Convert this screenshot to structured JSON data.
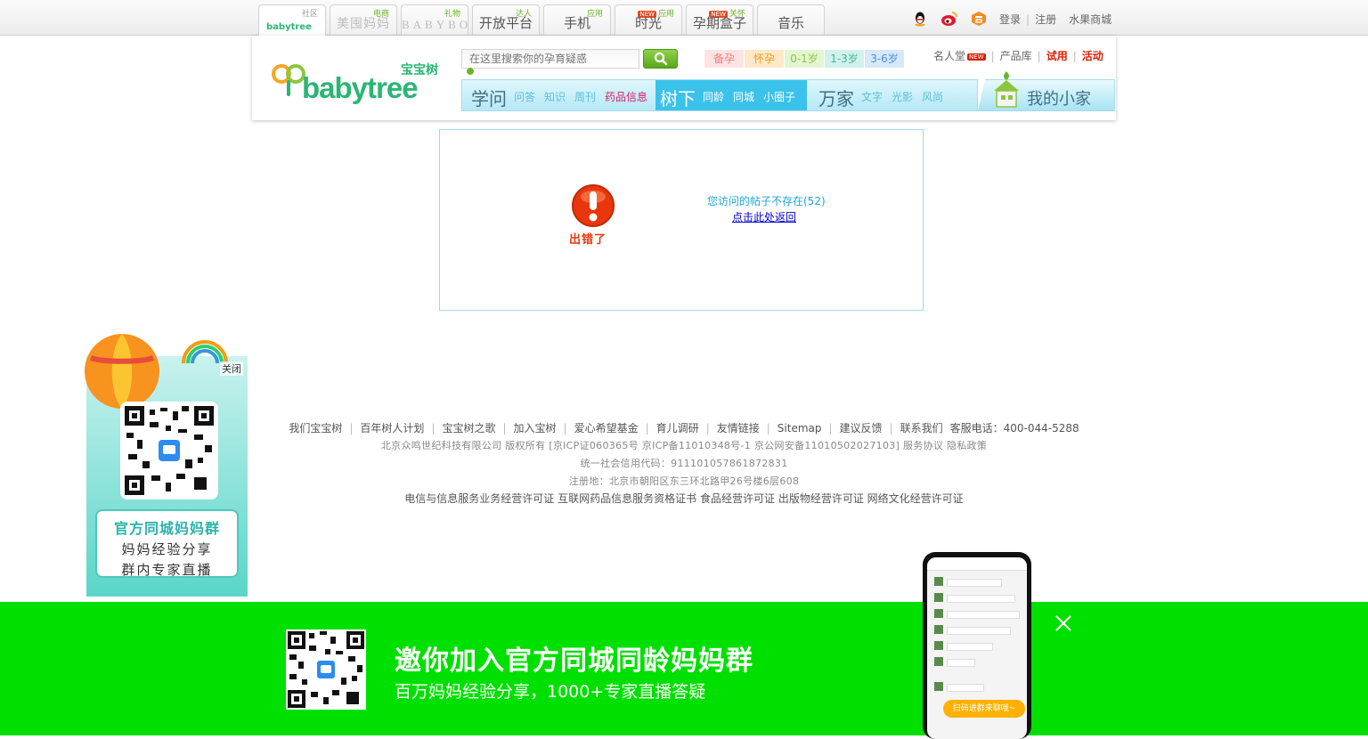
{
  "topbar": {
    "tabs": [
      {
        "tag": "社区",
        "name": "babytree"
      },
      {
        "tag": "电商",
        "name": "美囤妈妈"
      },
      {
        "tag": "礼物",
        "name": "BABYBOX"
      },
      {
        "tag": "达人",
        "name": "开放平台"
      },
      {
        "tag": "应用",
        "name": "手机"
      },
      {
        "tag_new": "NEW",
        "tag": "应用",
        "name": "时光"
      },
      {
        "tag_new": "NEW",
        "tag": "关怀",
        "name": "孕期盒子"
      },
      {
        "tag": "",
        "name": "音乐"
      }
    ],
    "social_icons": [
      "qq-icon",
      "weibo-icon",
      "douban-icon"
    ],
    "links": {
      "login": "登录",
      "register": "注册",
      "mall": "水果商城"
    }
  },
  "header": {
    "brand_cn": "宝宝树",
    "brand_en": "babytree",
    "search_placeholder": "在这里搜索你的孕育疑惑",
    "stages": [
      {
        "label": "备孕",
        "color": "#f08080",
        "bg": "#fde3e3"
      },
      {
        "label": "怀孕",
        "color": "#f39c12",
        "bg": "#fde9c9"
      },
      {
        "label": "0-1岁",
        "color": "#8cc63f",
        "bg": "#e4f5d2"
      },
      {
        "label": "1-3岁",
        "color": "#3cb89f",
        "bg": "#d2f1ea"
      },
      {
        "label": "3-6岁",
        "color": "#4a90d9",
        "bg": "#d6e8fa"
      }
    ],
    "right_links": {
      "famous": "名人堂",
      "new_badge": "NEW",
      "products": "产品库",
      "trial": "试用",
      "events": "活动"
    },
    "nav": {
      "group1": {
        "title": "学问",
        "items": [
          "问答",
          "知识",
          "周刊",
          "药品信息"
        ]
      },
      "group2": {
        "title": "树下",
        "items": [
          "同龄",
          "同城",
          "小圈子"
        ]
      },
      "group3": {
        "title": "万家",
        "items": [
          "文字",
          "光影",
          "风尚"
        ]
      },
      "home": "我的小家"
    }
  },
  "error": {
    "icon_text": "出错了",
    "message": "您访问的帖子不存在(52)",
    "back_link": "点击此处返回"
  },
  "footer": {
    "nav": [
      "我们宝宝树",
      "百年树人计划",
      "宝宝树之歌",
      "加入宝树",
      "爱心希望基金",
      "育儿调研",
      "友情链接",
      "Sitemap",
      "建议反馈",
      "联系我们"
    ],
    "hotline": "客服电话：400-044-5288",
    "copyright": "北京众鸣世纪科技有限公司 版权所有 [京ICP证060365号 京ICP备11010348号-1 京公网安备11010502027103] 服务协议 隐私政策",
    "credit_code": "统一社会信用代码：911101057861872831",
    "address": "注册地：北京市朝阳区东三环北路甲26号楼6层608",
    "licenses": [
      "电信与信息服务业务经营许可证",
      "互联网药品信息服务资格证书",
      "食品经营许可证",
      "出版物经营许可证",
      "网络文化经营许可证"
    ]
  },
  "float_ad": {
    "close": "关闭",
    "title": "官方同城妈妈群",
    "line1": "妈妈经验分享",
    "line2": "群内专家直播"
  },
  "banner": {
    "title": "邀你加入官方同城同龄妈妈群",
    "subtitle": "百万妈妈经验分享，1000+专家直播答疑",
    "phone_bubble": "扫码进群来聊哦~"
  }
}
